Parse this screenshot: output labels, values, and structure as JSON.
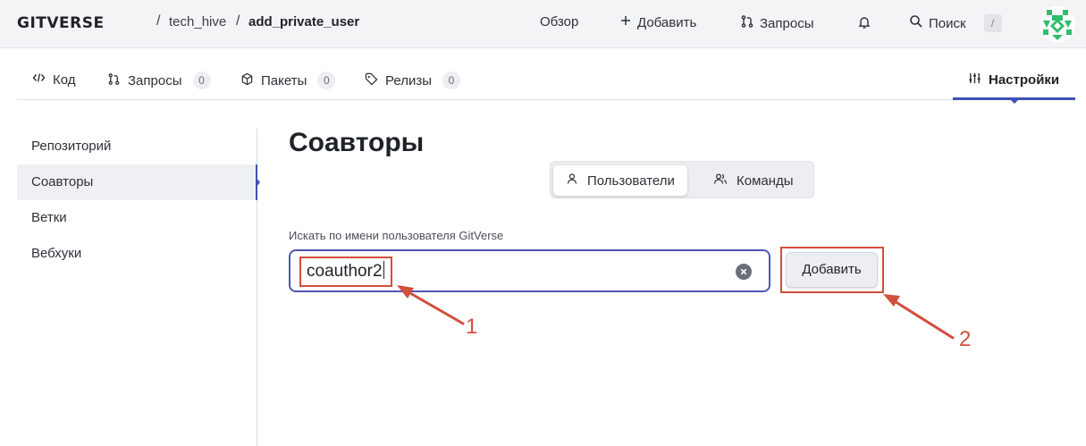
{
  "header": {
    "logo": "GITVERSE",
    "breadcrumb": {
      "sep1": "/",
      "owner": "tech_hive",
      "sep2": "/",
      "repo": "add_private_user"
    },
    "nav": {
      "overview": "Обзор",
      "add": "Добавить",
      "requests": "Запросы",
      "search": "Поиск",
      "search_shortcut": "/"
    }
  },
  "tabs": [
    {
      "label": "Код",
      "icon": "code-icon"
    },
    {
      "label": "Запросы",
      "count": "0",
      "icon": "pull-request-icon"
    },
    {
      "label": "Пакеты",
      "count": "0",
      "icon": "package-icon"
    },
    {
      "label": "Релизы",
      "count": "0",
      "icon": "tag-icon"
    },
    {
      "label": "Настройки",
      "icon": "sliders-icon",
      "active": true
    }
  ],
  "sidebar": {
    "items": [
      {
        "label": "Репозиторий"
      },
      {
        "label": "Соавторы",
        "active": true
      },
      {
        "label": "Ветки"
      },
      {
        "label": "Вебхуки"
      }
    ]
  },
  "main": {
    "title": "Соавторы",
    "segment": {
      "users": "Пользователи",
      "teams": "Команды",
      "selected": "users"
    },
    "search": {
      "label": "Искать по имени пользователя GitVerse",
      "value": "coauthor2"
    },
    "add_button": "Добавить"
  },
  "annotations": {
    "first": "1",
    "second": "2",
    "color": "#d14f3b"
  },
  "colors": {
    "accent": "#3f51b5",
    "input_border": "#4d55b8",
    "annotation": "#d14f3b"
  }
}
